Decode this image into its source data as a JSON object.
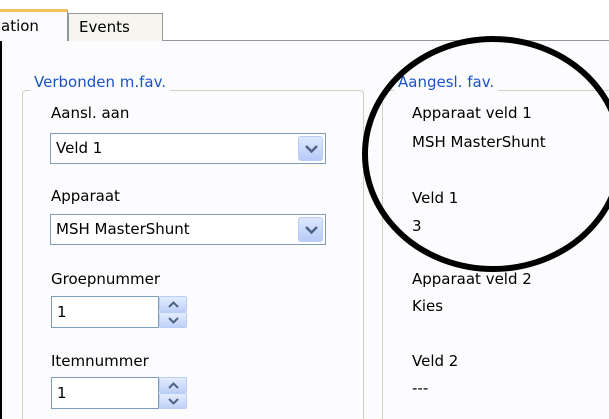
{
  "tabs": [
    {
      "label": "ation"
    },
    {
      "label": "Events"
    }
  ],
  "left_group": {
    "title": "Verbonden m.fav.",
    "connect_label": "Aansl. aan",
    "connect_value": "Veld 1",
    "device_label": "Apparaat",
    "device_value": "MSH MasterShunt",
    "group_number_label": "Groepnummer",
    "group_number_value": "1",
    "item_number_label": "Itemnummer",
    "item_number_value": "1"
  },
  "right_group": {
    "title": "Aangesl. fav.",
    "device_field1_label": "Apparaat veld 1",
    "device_field1_value": "MSH MasterShunt",
    "field1_label": "Veld 1",
    "field1_value": "3",
    "device_field2_label": "Apparaat veld 2",
    "device_field2_value": "Kies",
    "field2_label": "Veld 2",
    "field2_value": "---"
  },
  "icons": {
    "dropdown": "chevron-down-icon",
    "spin_up": "arrow-up-icon",
    "spin_down": "arrow-down-icon"
  },
  "colors": {
    "legend_text": "#1a52c8",
    "active_tab_highlight": "#f1c15f",
    "control_border": "#7f9db9",
    "annotation": "#000000"
  }
}
